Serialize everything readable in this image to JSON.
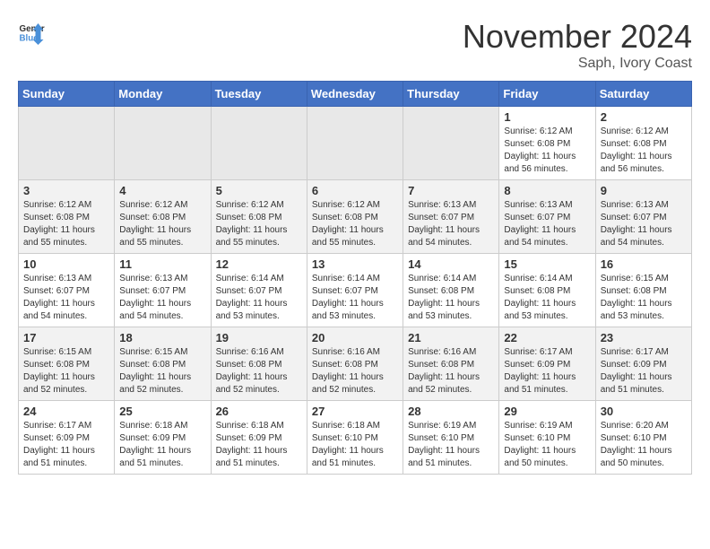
{
  "header": {
    "logo_line1": "General",
    "logo_line2": "Blue",
    "month_title": "November 2024",
    "location": "Saph, Ivory Coast"
  },
  "weekdays": [
    "Sunday",
    "Monday",
    "Tuesday",
    "Wednesday",
    "Thursday",
    "Friday",
    "Saturday"
  ],
  "weeks": [
    [
      {
        "day": "",
        "content": ""
      },
      {
        "day": "",
        "content": ""
      },
      {
        "day": "",
        "content": ""
      },
      {
        "day": "",
        "content": ""
      },
      {
        "day": "",
        "content": ""
      },
      {
        "day": "1",
        "content": "Sunrise: 6:12 AM\nSunset: 6:08 PM\nDaylight: 11 hours and 56 minutes."
      },
      {
        "day": "2",
        "content": "Sunrise: 6:12 AM\nSunset: 6:08 PM\nDaylight: 11 hours and 56 minutes."
      }
    ],
    [
      {
        "day": "3",
        "content": "Sunrise: 6:12 AM\nSunset: 6:08 PM\nDaylight: 11 hours and 55 minutes."
      },
      {
        "day": "4",
        "content": "Sunrise: 6:12 AM\nSunset: 6:08 PM\nDaylight: 11 hours and 55 minutes."
      },
      {
        "day": "5",
        "content": "Sunrise: 6:12 AM\nSunset: 6:08 PM\nDaylight: 11 hours and 55 minutes."
      },
      {
        "day": "6",
        "content": "Sunrise: 6:12 AM\nSunset: 6:08 PM\nDaylight: 11 hours and 55 minutes."
      },
      {
        "day": "7",
        "content": "Sunrise: 6:13 AM\nSunset: 6:07 PM\nDaylight: 11 hours and 54 minutes."
      },
      {
        "day": "8",
        "content": "Sunrise: 6:13 AM\nSunset: 6:07 PM\nDaylight: 11 hours and 54 minutes."
      },
      {
        "day": "9",
        "content": "Sunrise: 6:13 AM\nSunset: 6:07 PM\nDaylight: 11 hours and 54 minutes."
      }
    ],
    [
      {
        "day": "10",
        "content": "Sunrise: 6:13 AM\nSunset: 6:07 PM\nDaylight: 11 hours and 54 minutes."
      },
      {
        "day": "11",
        "content": "Sunrise: 6:13 AM\nSunset: 6:07 PM\nDaylight: 11 hours and 54 minutes."
      },
      {
        "day": "12",
        "content": "Sunrise: 6:14 AM\nSunset: 6:07 PM\nDaylight: 11 hours and 53 minutes."
      },
      {
        "day": "13",
        "content": "Sunrise: 6:14 AM\nSunset: 6:07 PM\nDaylight: 11 hours and 53 minutes."
      },
      {
        "day": "14",
        "content": "Sunrise: 6:14 AM\nSunset: 6:08 PM\nDaylight: 11 hours and 53 minutes."
      },
      {
        "day": "15",
        "content": "Sunrise: 6:14 AM\nSunset: 6:08 PM\nDaylight: 11 hours and 53 minutes."
      },
      {
        "day": "16",
        "content": "Sunrise: 6:15 AM\nSunset: 6:08 PM\nDaylight: 11 hours and 53 minutes."
      }
    ],
    [
      {
        "day": "17",
        "content": "Sunrise: 6:15 AM\nSunset: 6:08 PM\nDaylight: 11 hours and 52 minutes."
      },
      {
        "day": "18",
        "content": "Sunrise: 6:15 AM\nSunset: 6:08 PM\nDaylight: 11 hours and 52 minutes."
      },
      {
        "day": "19",
        "content": "Sunrise: 6:16 AM\nSunset: 6:08 PM\nDaylight: 11 hours and 52 minutes."
      },
      {
        "day": "20",
        "content": "Sunrise: 6:16 AM\nSunset: 6:08 PM\nDaylight: 11 hours and 52 minutes."
      },
      {
        "day": "21",
        "content": "Sunrise: 6:16 AM\nSunset: 6:08 PM\nDaylight: 11 hours and 52 minutes."
      },
      {
        "day": "22",
        "content": "Sunrise: 6:17 AM\nSunset: 6:09 PM\nDaylight: 11 hours and 51 minutes."
      },
      {
        "day": "23",
        "content": "Sunrise: 6:17 AM\nSunset: 6:09 PM\nDaylight: 11 hours and 51 minutes."
      }
    ],
    [
      {
        "day": "24",
        "content": "Sunrise: 6:17 AM\nSunset: 6:09 PM\nDaylight: 11 hours and 51 minutes."
      },
      {
        "day": "25",
        "content": "Sunrise: 6:18 AM\nSunset: 6:09 PM\nDaylight: 11 hours and 51 minutes."
      },
      {
        "day": "26",
        "content": "Sunrise: 6:18 AM\nSunset: 6:09 PM\nDaylight: 11 hours and 51 minutes."
      },
      {
        "day": "27",
        "content": "Sunrise: 6:18 AM\nSunset: 6:10 PM\nDaylight: 11 hours and 51 minutes."
      },
      {
        "day": "28",
        "content": "Sunrise: 6:19 AM\nSunset: 6:10 PM\nDaylight: 11 hours and 51 minutes."
      },
      {
        "day": "29",
        "content": "Sunrise: 6:19 AM\nSunset: 6:10 PM\nDaylight: 11 hours and 50 minutes."
      },
      {
        "day": "30",
        "content": "Sunrise: 6:20 AM\nSunset: 6:10 PM\nDaylight: 11 hours and 50 minutes."
      }
    ]
  ]
}
